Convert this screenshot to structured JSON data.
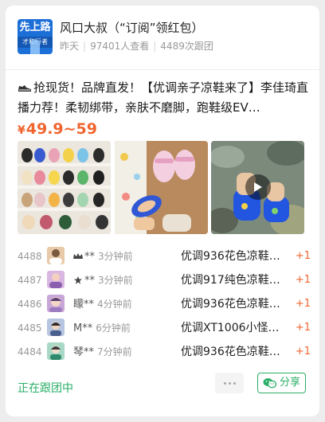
{
  "header": {
    "avatar_top": "先上路",
    "avatar_bottom": "才和行者",
    "title": "风口大叔（“订阅”领红包）",
    "time": "昨天",
    "views": "97401人查看",
    "followers": "4489次跟团"
  },
  "post": {
    "description": "抢现货！品牌直发！【优调亲子凉鞋来了】李佳琦直播力荐！柔韧绑带，亲肤不磨脚，跑鞋级EV…",
    "price_symbol": "¥",
    "price": "49.9~59"
  },
  "photos": [
    {
      "icon": "shoe-shelf-photo"
    },
    {
      "icon": "kids-sandals-photo"
    },
    {
      "icon": "blue-sandals-video",
      "is_video": true
    }
  ],
  "orders": [
    {
      "num": "4488",
      "name": "**",
      "time": "3分钟前",
      "item": "优调936花色凉鞋…",
      "qty": "+1",
      "avatar_color": "#e8c9a8",
      "mini_icon": "crown-icon"
    },
    {
      "num": "4487",
      "name": "**",
      "time": "3分钟前",
      "item": "优调917纯色凉鞋…",
      "qty": "+1",
      "avatar_color": "#d9b7e0",
      "mini_icon": "star-icon"
    },
    {
      "num": "4486",
      "name": "矇**",
      "time": "4分钟前",
      "item": "优调936花色凉鞋…",
      "qty": "+1",
      "avatar_color": "#c9a6d8"
    },
    {
      "num": "4485",
      "name": "M**",
      "time": "6分钟前",
      "item": "优调XT1006小怪兽…",
      "qty": "+1",
      "avatar_color": "#b7c5e0"
    },
    {
      "num": "4484",
      "name": "琴**",
      "time": "7分钟前",
      "item": "优调936花色凉鞋…",
      "qty": "+1",
      "avatar_color": "#a9d8c6"
    }
  ],
  "footer": {
    "following": "正在跟团中",
    "share": "分享"
  },
  "colors": {
    "accent_orange": "#f0652f",
    "wechat_green": "#2aae67"
  }
}
